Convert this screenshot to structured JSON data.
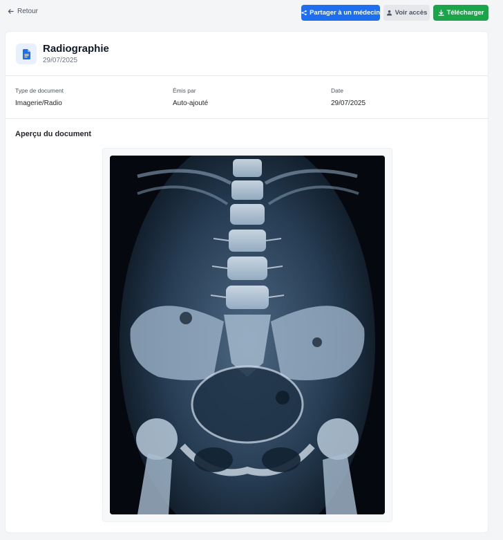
{
  "nav": {
    "back_label": "Retour"
  },
  "actions": {
    "share_label": "Partager à un médecin",
    "access_label": "Voir accès",
    "download_label": "Télécharger"
  },
  "document": {
    "title": "Radiographie",
    "date": "29/07/2025",
    "icon": "document-icon"
  },
  "meta": [
    {
      "label": "Type de document",
      "value": "Imagerie/Radio"
    },
    {
      "label": "Émis par",
      "value": "Auto-ajouté"
    },
    {
      "label": "Date",
      "value": "29/07/2025"
    }
  ],
  "preview": {
    "title": "Aperçu du document"
  },
  "colors": {
    "share": "#1d6ff0",
    "download": "#1ba54a",
    "access": "#e5e7eb",
    "icon_bg": "#e8f0fe"
  }
}
